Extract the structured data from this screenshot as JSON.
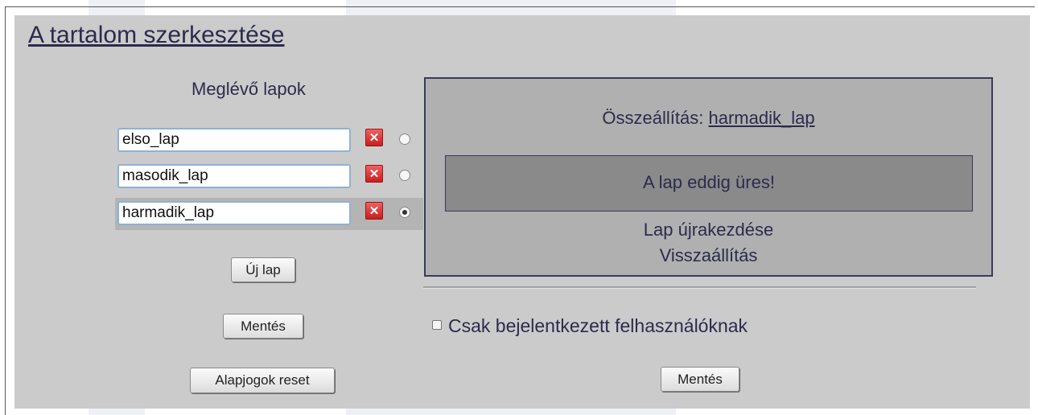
{
  "title": "A tartalom szerkesztése",
  "pages": {
    "heading": "Meglévő lapok",
    "items": [
      {
        "name": "elso_lap",
        "selected": false
      },
      {
        "name": "masodik_lap",
        "selected": false
      },
      {
        "name": "harmadik_lap",
        "selected": true
      }
    ],
    "new_page_label": "Új lap",
    "save_label": "Mentés",
    "reset_rights_label": "Alapjogok reset"
  },
  "composer": {
    "title_prefix": "Összeállítás:",
    "current_page": "harmadik_lap",
    "empty_message": "A lap eddig üres!",
    "restart_label": "Lap újrakezdése",
    "restore_label": "Visszaállítás"
  },
  "options": {
    "logged_in_only_label": "Csak bejelentkezett felhasználóknak",
    "logged_in_only_checked": false,
    "save_label": "Mentés"
  },
  "icons": {
    "delete": "delete-icon",
    "radio": "radio-icon"
  },
  "colors": {
    "panel_bg": "#cbcbcb",
    "composer_bg": "#b0b0b0",
    "empty_box_bg": "#8a8a8a",
    "text": "#2b2b4e",
    "delete_red": "#d92b2b"
  }
}
